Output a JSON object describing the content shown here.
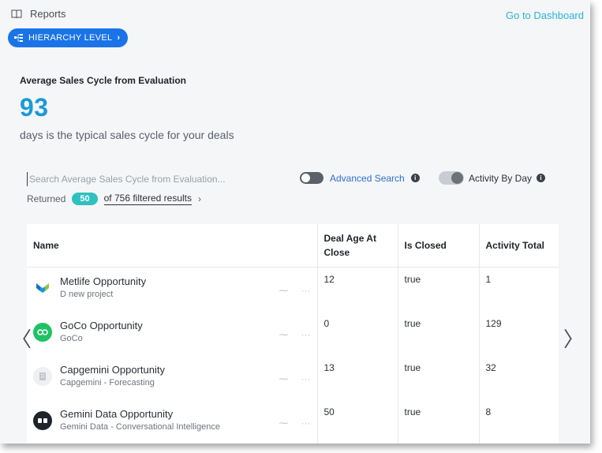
{
  "topbar": {
    "title": "Reports",
    "dashboard_link": "Go to Dashboard"
  },
  "hierarchy": {
    "label": "HIERARCHY LEVEL"
  },
  "metric": {
    "title": "Average Sales Cycle from Evaluation",
    "value": "93",
    "subtitle": "days is the typical sales cycle for your deals"
  },
  "search": {
    "placeholder": "Search Average Sales Cycle from Evaluation..."
  },
  "toggles": {
    "advanced_label": "Advanced Search",
    "activity_label": "Activity By Day"
  },
  "results": {
    "prefix": "Returned",
    "count": "50",
    "filtered_text": "of 756 filtered results"
  },
  "table": {
    "headers": {
      "name": "Name",
      "deal_age": "Deal Age At Close",
      "closed": "Is Closed",
      "activity": "Activity Total"
    },
    "rows": [
      {
        "name": "Metlife Opportunity",
        "sub": "D new project",
        "deal_age": "12",
        "closed": "true",
        "activity": "1"
      },
      {
        "name": "GoCo Opportunity",
        "sub": "GoCo",
        "deal_age": "0",
        "closed": "true",
        "activity": "129"
      },
      {
        "name": "Capgemini Opportunity",
        "sub": "Capgemini - Forecasting",
        "deal_age": "13",
        "closed": "true",
        "activity": "32"
      },
      {
        "name": "Gemini Data Opportunity",
        "sub": "Gemini Data - Conversational Intelligence",
        "deal_age": "50",
        "closed": "true",
        "activity": "8"
      }
    ]
  },
  "colors": {
    "accent_blue": "#1a73e8",
    "metric_blue": "#1a9ad9",
    "link_teal": "#27b5d6",
    "badge_teal": "#2fc0c0"
  },
  "icons": {
    "book": "book-icon",
    "hierarchy": "hierarchy-icon",
    "info": "info-icon",
    "prev": "chevron-left-icon",
    "next": "chevron-right-icon"
  }
}
